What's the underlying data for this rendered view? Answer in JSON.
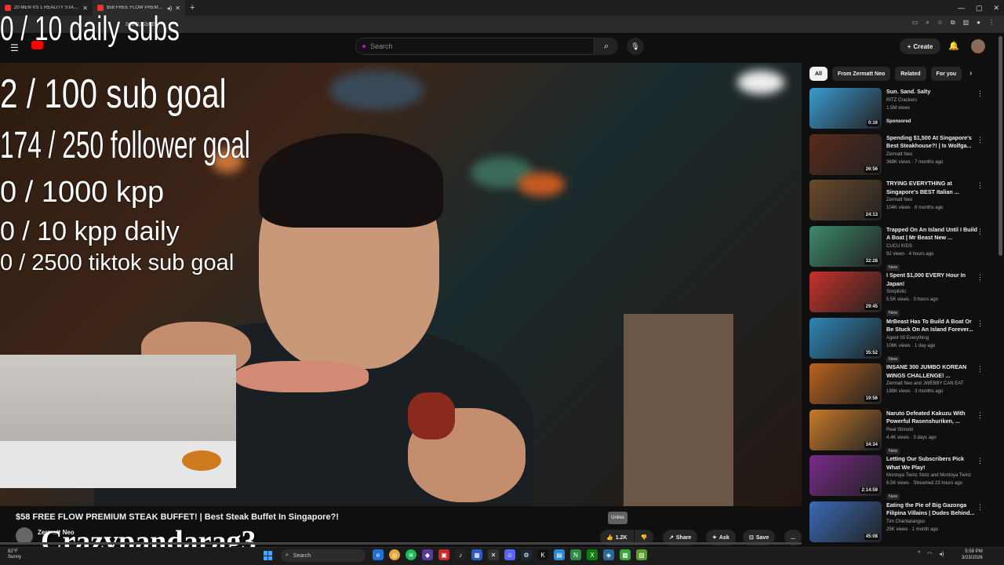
{
  "browser": {
    "tabs": [
      {
        "title": "20 MEN VS 1 REALITY STAR | C...",
        "active": false
      },
      {
        "title": "$58 FREE FLOW PREMIUM...",
        "active": true
      }
    ],
    "new_tab": "+",
    "url": "8soTUSbFE"
  },
  "header": {
    "search_placeholder": "Search",
    "create_label": "Create"
  },
  "overlay": {
    "daily_subs": "0 / 10 daily subs",
    "sub_goal": "2  / 100 sub goal",
    "follower_goal": "174 / 250 follower goal",
    "kpp": "0 / 1000 kpp",
    "kpp_daily": "0 / 10 kpp daily",
    "tiktok_goal": "0 / 2500 tiktok sub goal",
    "watermark": "Crazypandarag3"
  },
  "video": {
    "title": "$58 FREE FLOW PREMIUM STEAK BUFFET! | Best Steak Buffet In Singapore?!",
    "channel": "Zermatt Neo",
    "tooltip": "Unlike",
    "likes": "1.2K",
    "share_label": "Share",
    "ask_label": "Ask",
    "save_label": "Save",
    "more_label": "...",
    "progress": 0.0
  },
  "chips": [
    {
      "label": "All",
      "active": true
    },
    {
      "label": "From Zermatt Neo",
      "active": false
    },
    {
      "label": "Related",
      "active": false
    },
    {
      "label": "For you",
      "active": false
    }
  ],
  "recommendations": [
    {
      "title": "Sun. Sand. Salty",
      "channel": "RITZ Crackers",
      "views": "1.5M views",
      "extra": "Sponsored",
      "duration": "0:16",
      "thumb": "#3a9bd0"
    },
    {
      "title": "Spending $1,500 At Singapore's Best Steakhouse?! | Is Wolfga...",
      "channel": "Zermatt Neo",
      "views": "368K views · 7 months ago",
      "extra": "",
      "duration": "26:56",
      "thumb": "#5a2a1a"
    },
    {
      "title": "TRYING EVERYTHING at Singapore's BEST Italian ...",
      "channel": "Zermatt Neo",
      "views": "104K views · 6 months ago",
      "extra": "",
      "duration": "24:13",
      "thumb": "#6a4a2a"
    },
    {
      "title": "Trapped On An Island Until I Build A Boat | Mr Beast New ...",
      "channel": "CUCU KIDS",
      "views": "92 views · 4 hours ago",
      "extra": "New",
      "duration": "32:28",
      "thumb": "#3d8a6a"
    },
    {
      "title": "I Spent $1,000 EVERY Hour In Japan!",
      "channel": "Simplistic",
      "views": "5.5K views · 3 hours ago",
      "extra": "New",
      "duration": "29:45",
      "thumb": "#c8322a"
    },
    {
      "title": "MrBeast Has To Build A Boat Or Be Stuck On An Island Forever...",
      "channel": "Agent 00 Everything",
      "views": "106K views · 1 day ago",
      "extra": "New",
      "duration": "35:52",
      "thumb": "#2f86b8"
    },
    {
      "title": "INSANE 300 JUMBO KOREAN WINGS CHALLENGE! ...",
      "channel": "Zermatt Neo and JWEBBY CAN EAT",
      "views": "198K views · 3 months ago",
      "extra": "",
      "duration": "19:56",
      "thumb": "#b8621e"
    },
    {
      "title": "Naruto Defeated Kakuzu With Powerful Rasenshuriken, ...",
      "channel": "Real Shinobi",
      "views": "4.4K views · 3 days ago",
      "extra": "New",
      "duration": "34:34",
      "thumb": "#c87a2a"
    },
    {
      "title": "Letting Our Subscribers Pick What We Play!",
      "channel": "Montoya Twinz Slotz and Montoya Twinz",
      "views": "6.5K views · Streamed 23 hours ago",
      "extra": "New",
      "duration": "2:14:59",
      "thumb": "#7a2a8a"
    },
    {
      "title": "Eating the Pie of Big Gazonga Filipina Villains | Dudes Behind...",
      "channel": "Tim Chantarangsu",
      "views": "25K views · 1 month ago",
      "extra": "",
      "duration": "45:08",
      "thumb": "#3a6ab8"
    }
  ],
  "taskbar": {
    "temp": "82°F",
    "weather": "Sunny",
    "search": "Search",
    "time": "5:59 PM",
    "date": "3/23/2026"
  }
}
